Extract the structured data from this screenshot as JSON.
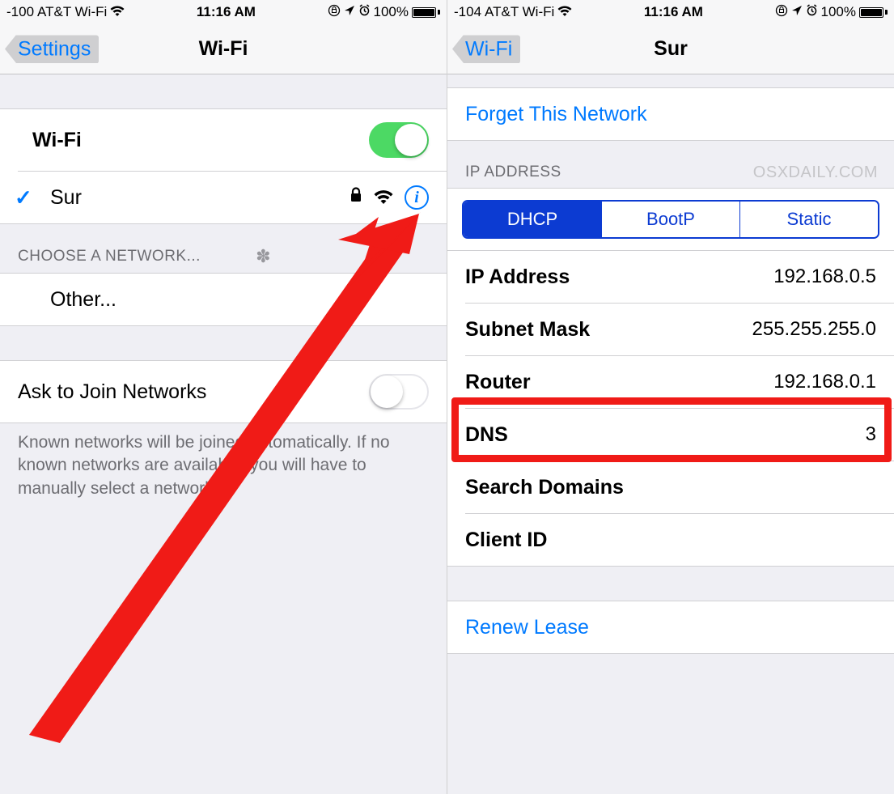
{
  "left": {
    "status": {
      "signal": "-100",
      "carrier": "AT&T Wi-Fi",
      "time": "11:16 AM",
      "battery": "100%"
    },
    "nav": {
      "back": "Settings",
      "title": "Wi-Fi"
    },
    "wifi_row": {
      "label": "Wi-Fi"
    },
    "connected": {
      "name": "Sur"
    },
    "choose_header": "CHOOSE A NETWORK...",
    "other": "Other...",
    "ask": {
      "label": "Ask to Join Networks"
    },
    "footer": "Known networks will be joined automatically. If no known networks are available, you will have to manually select a network."
  },
  "right": {
    "status": {
      "signal": "-104",
      "carrier": "AT&T Wi-Fi",
      "time": "11:16 AM",
      "battery": "100%"
    },
    "nav": {
      "back": "Wi-Fi",
      "title": "Sur"
    },
    "forget": "Forget This Network",
    "ip_header": "IP ADDRESS",
    "watermark": "osxdaily.com",
    "segments": {
      "dhcp": "DHCP",
      "bootp": "BootP",
      "static": "Static"
    },
    "rows": {
      "ip_label": "IP Address",
      "ip_value": "192.168.0.5",
      "subnet_label": "Subnet Mask",
      "subnet_value": "255.255.255.0",
      "router_label": "Router",
      "router_value": "192.168.0.1",
      "dns_label": "DNS",
      "dns_value": "3",
      "search_label": "Search Domains",
      "search_value": "",
      "client_label": "Client ID",
      "client_value": ""
    },
    "renew": "Renew Lease"
  }
}
